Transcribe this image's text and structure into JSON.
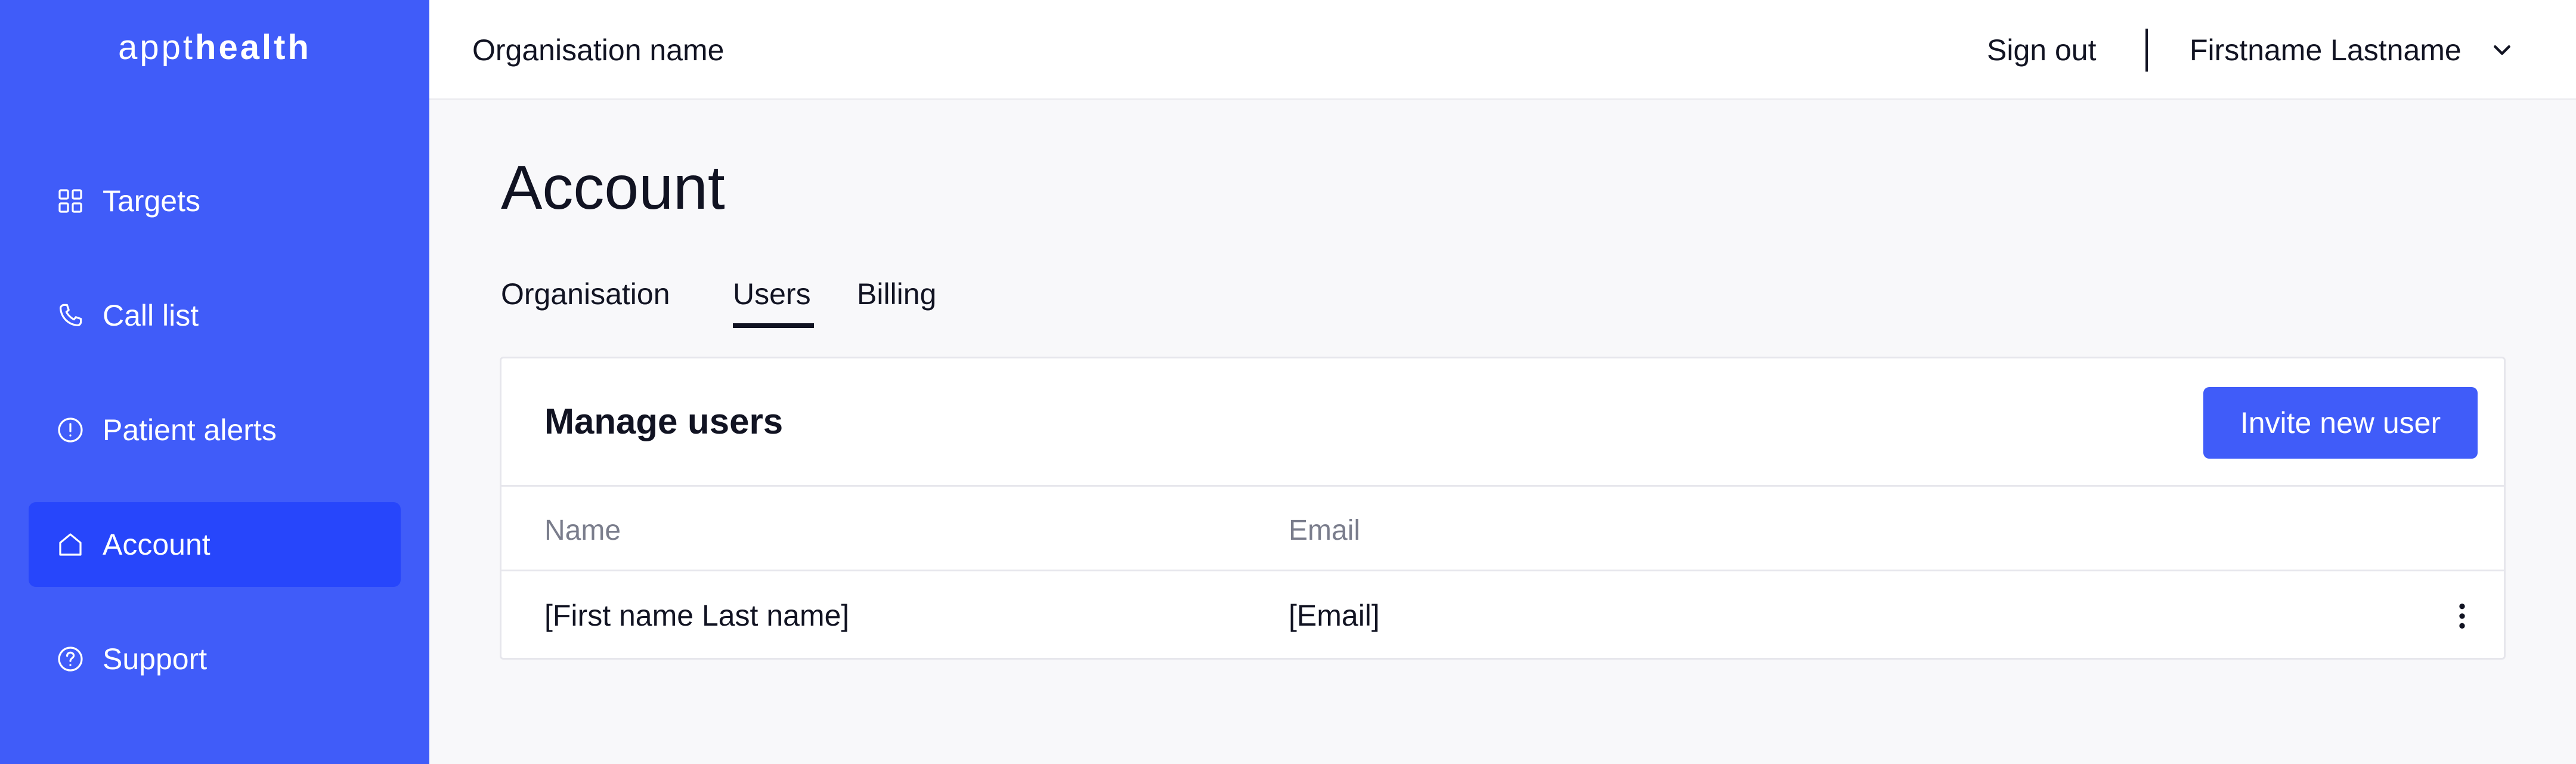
{
  "colors": {
    "sidebar": "#405cf9",
    "sidebar_active": "#2746fb",
    "accent": "#405cf9",
    "text": "#111322",
    "muted": "#7a7d8c",
    "background": "#f8f8fa"
  },
  "logo": {
    "light": "appt",
    "bold": "health"
  },
  "sidebar": {
    "items": [
      {
        "label": "Targets",
        "icon": "grid-icon",
        "active": false
      },
      {
        "label": "Call list",
        "icon": "phone-icon",
        "active": false
      },
      {
        "label": "Patient alerts",
        "icon": "alert-circle-icon",
        "active": false
      },
      {
        "label": "Account",
        "icon": "home-icon",
        "active": true
      },
      {
        "label": "Support",
        "icon": "help-circle-icon",
        "active": false
      }
    ]
  },
  "header": {
    "org_name": "Organisation name",
    "sign_out": "Sign out",
    "user_name": "Firstname Lastname"
  },
  "page": {
    "title": "Account",
    "tabs": [
      {
        "label": "Organisation",
        "active": false
      },
      {
        "label": "Users",
        "active": true
      },
      {
        "label": "Billing",
        "active": false
      }
    ]
  },
  "users": {
    "title": "Manage users",
    "invite_label": "Invite new user",
    "columns": [
      "Name",
      "Email"
    ],
    "rows": [
      {
        "name": "[First name Last name]",
        "email": "[Email]"
      }
    ]
  }
}
